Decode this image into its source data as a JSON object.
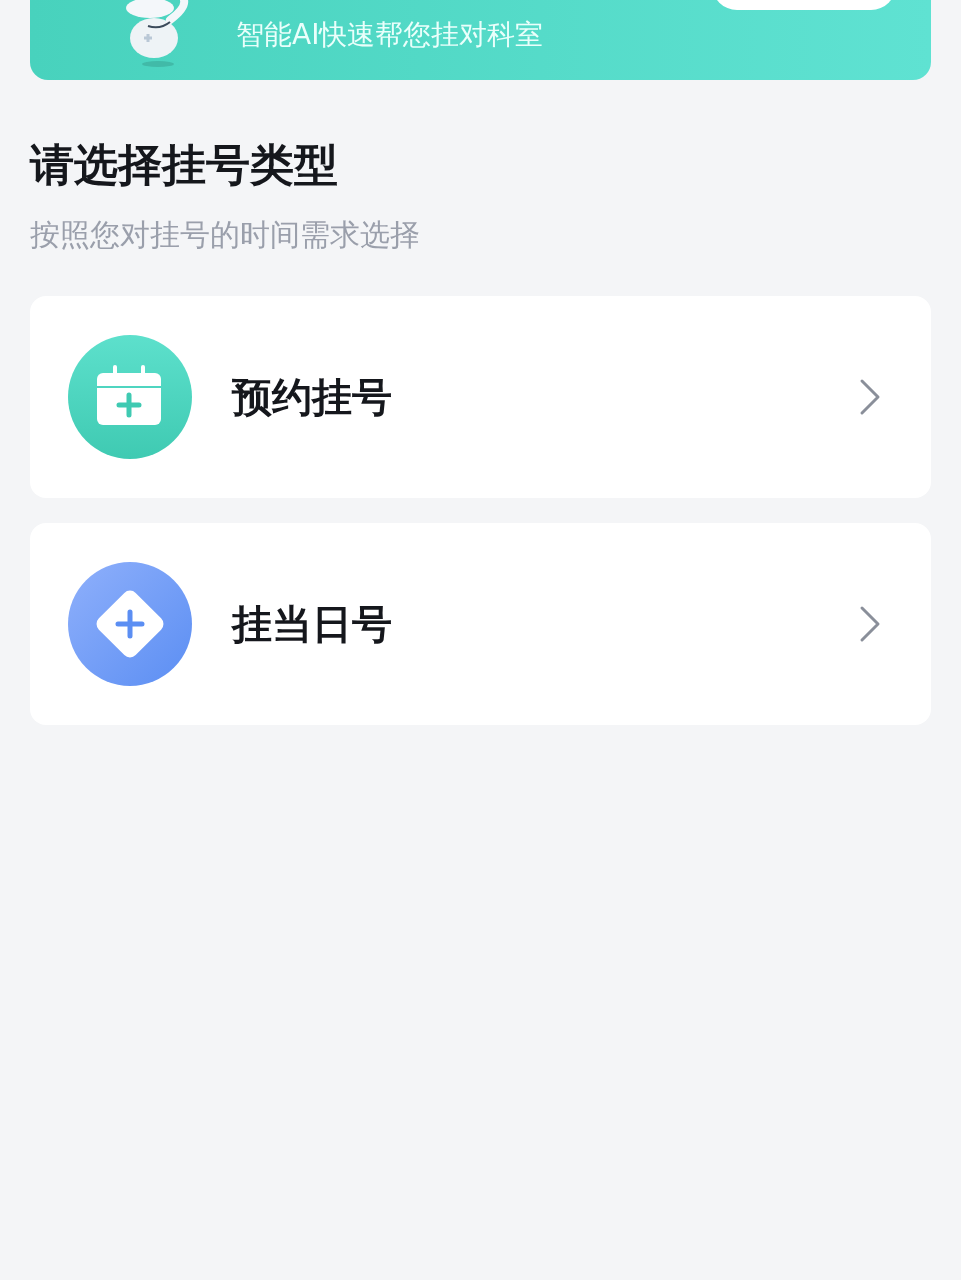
{
  "banner": {
    "subtitle": "智能AI快速帮您挂对科室"
  },
  "section": {
    "title": "请选择挂号类型",
    "subtitle": "按照您对挂号的时间需求选择"
  },
  "options": [
    {
      "kind": "calendar",
      "label": "预约挂号"
    },
    {
      "kind": "diamond",
      "label": "挂当日号"
    }
  ]
}
